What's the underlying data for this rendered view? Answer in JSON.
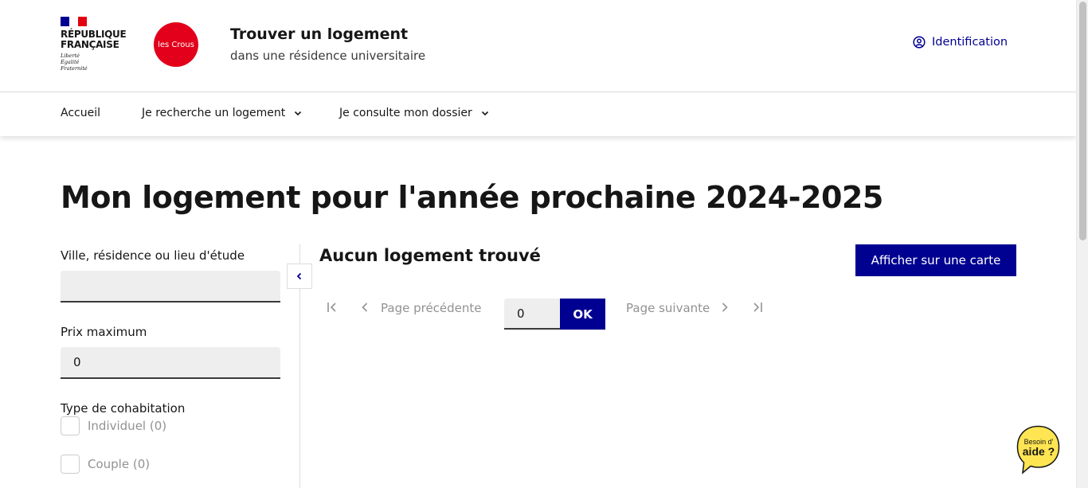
{
  "header": {
    "gov_name_line1": "RÉPUBLIQUE",
    "gov_name_line2": "FRANÇAISE",
    "motto_line1": "Liberté",
    "motto_line2": "Égalité",
    "motto_line3": "Fraternité",
    "crous_logo_text": "les Crous",
    "site_title": "Trouver un logement",
    "site_tagline": "dans une résidence universitaire",
    "login_label": "Identification"
  },
  "nav": {
    "items": [
      {
        "label": "Accueil"
      },
      {
        "label": "Je recherche un logement"
      },
      {
        "label": "Je consulte mon dossier"
      }
    ]
  },
  "page_title": "Mon logement pour l'année prochaine 2024-2025",
  "filters": {
    "location_label": "Ville, résidence ou lieu d'étude",
    "location_value": "",
    "price_label": "Prix maximum",
    "price_value": "0",
    "cohab_label": "Type de cohabitation",
    "options": [
      {
        "label": "Individuel (0)",
        "checked": false
      },
      {
        "label": "Couple (0)",
        "checked": false
      }
    ]
  },
  "results": {
    "title": "Aucun logement trouvé",
    "map_button": "Afficher sur une carte"
  },
  "pagination": {
    "prev_label": "Page précédente",
    "next_label": "Page suivante",
    "page_value": "0",
    "ok_label": "OK"
  },
  "help": {
    "line1": "Besoin d'",
    "line2": "aide ?"
  },
  "colors": {
    "primary": "#000091",
    "crous_red": "#e2001a",
    "help_yellow": "#ffe552"
  }
}
